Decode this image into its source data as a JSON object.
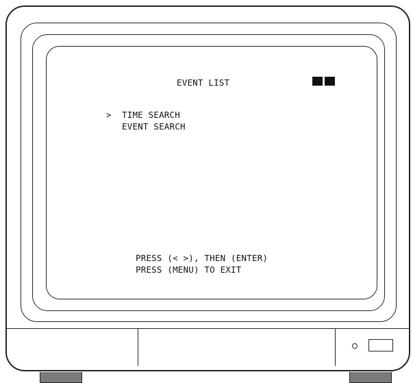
{
  "screen": {
    "title": "EVENT LIST",
    "cursor": ">",
    "menu_items": [
      {
        "label": "TIME SEARCH",
        "selected": true
      },
      {
        "label": "EVENT SEARCH",
        "selected": false
      }
    ],
    "hints": [
      "PRESS (< >), THEN (ENTER)",
      "PRESS (MENU) TO EXIT"
    ],
    "status_indicators": 2
  },
  "colors": {
    "line": "#222222",
    "text": "#111111",
    "foot": "#7a7a7a",
    "background": "#ffffff"
  }
}
